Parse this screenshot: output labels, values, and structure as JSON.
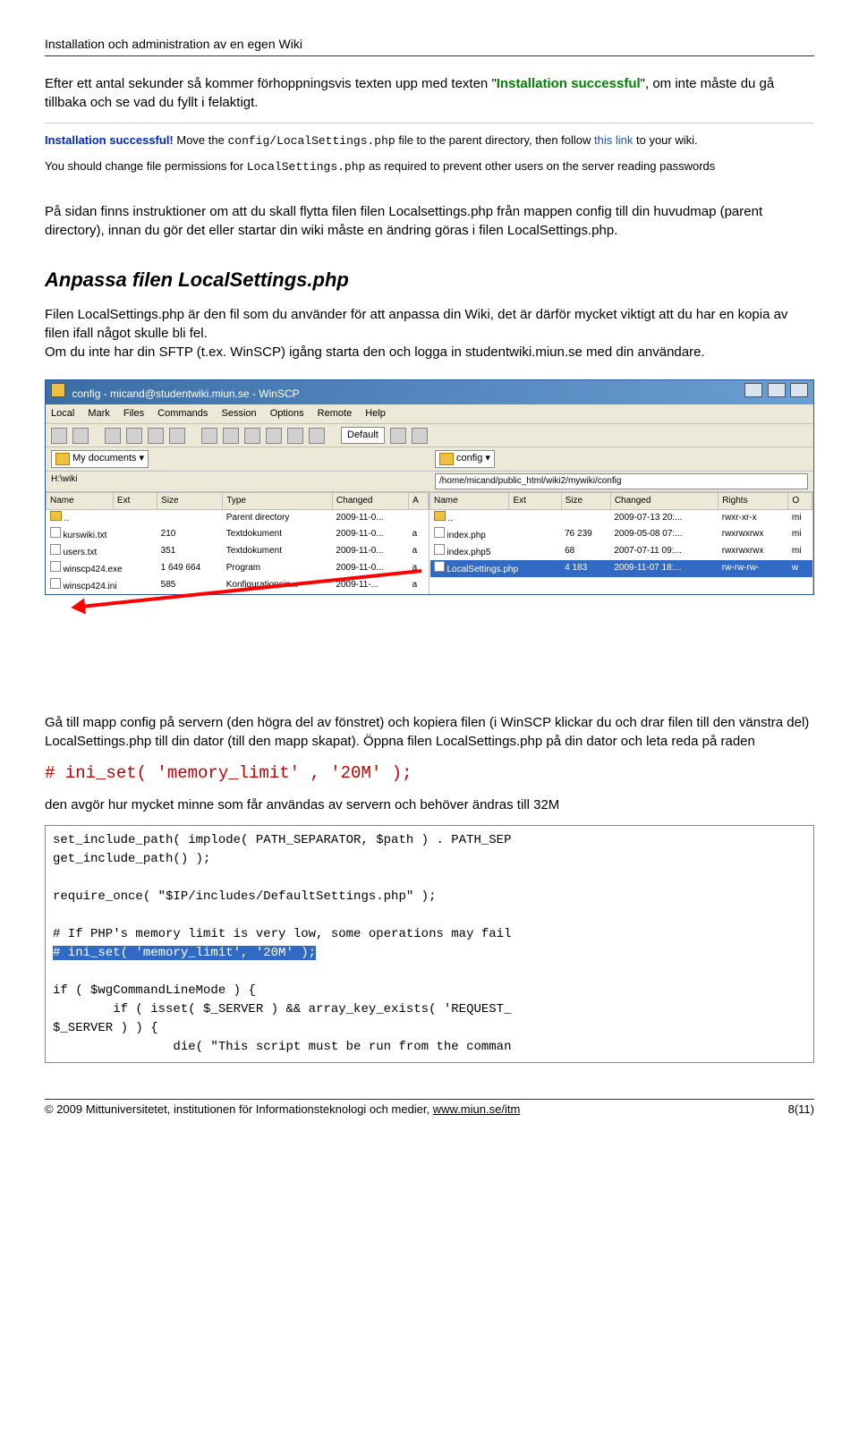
{
  "header": "Installation och administration av en egen Wiki",
  "p1a": "Efter ett antal sekunder så kommer förhoppningsvis texten upp med texten \"",
  "p1b": "Installation successful",
  "p1c": "\", om inte måste du gå tillbaka och se vad du fyllt i felaktigt.",
  "install_box": {
    "l1a": "Installation successful!",
    "l1b": " Move the ",
    "l1c": "config/LocalSettings.php",
    "l1d": " file to the parent directory, then follow ",
    "l1e": "this link",
    "l1f": " to your wiki.",
    "l2a": "You should change file permissions for ",
    "l2b": "LocalSettings.php",
    "l2c": " as required to prevent other users on the server reading passwords"
  },
  "p2": "På sidan finns instruktioner om att du skall flytta filen filen Localsettings.php från mappen config till  din huvudmap (parent directory), innan du  gör det eller startar din wiki måste en ändring göras i filen LocalSettings.php.",
  "h2": "Anpassa filen LocalSettings.php",
  "p3": "Filen LocalSettings.php är den fil som du använder för att anpassa din Wiki, det är därför mycket viktigt att du har en kopia av filen ifall något skulle bli fel.\nOm du inte har din SFTP (t.ex. WinSCP) igång starta den och logga in studentwiki.miun.se med din användare.",
  "winscp": {
    "title": "config - micand@studentwiki.miun.se - WinSCP",
    "menu": [
      "Local",
      "Mark",
      "Files",
      "Commands",
      "Session",
      "Options",
      "Remote",
      "Help"
    ],
    "combo": "Default",
    "left_dropdown": "My documents",
    "right_dropdown": "config",
    "left_loc": "H:\\wiki",
    "right_path": "/home/micand/public_html/wiki2/mywiki/config",
    "left_cols": [
      "Name",
      "Ext",
      "Size",
      "Type",
      "Changed",
      "A"
    ],
    "right_cols": [
      "Name",
      "Ext",
      "Size",
      "Changed",
      "Rights",
      "O"
    ],
    "left_rows": [
      {
        "name": "..",
        "size": "",
        "type": "Parent directory",
        "changed": "2009-11-0...",
        "a": ""
      },
      {
        "name": "kurswiki.txt",
        "size": "210",
        "type": "Textdokument",
        "changed": "2009-11-0...",
        "a": "a"
      },
      {
        "name": "users.txt",
        "size": "351",
        "type": "Textdokument",
        "changed": "2009-11-0...",
        "a": "a"
      },
      {
        "name": "winscp424.exe",
        "size": "1 649 664",
        "type": "Program",
        "changed": "2009-11-0...",
        "a": "a"
      },
      {
        "name": "winscp424.ini",
        "size": "585",
        "type": "Konfigurationsin...",
        "changed": "2009-11-...",
        "a": "a"
      }
    ],
    "right_rows": [
      {
        "name": "..",
        "size": "",
        "changed": "2009-07-13 20:...",
        "rights": "rwxr-xr-x",
        "o": "mi"
      },
      {
        "name": "index.php",
        "size": "76 239",
        "changed": "2009-05-08 07:...",
        "rights": "rwxrwxrwx",
        "o": "mi"
      },
      {
        "name": "index.php5",
        "size": "68",
        "changed": "2007-07-11 09:...",
        "rights": "rwxrwxrwx",
        "o": "mi"
      },
      {
        "name": "LocalSettings.php",
        "size": "4 183",
        "changed": "2009-11-07 18:...",
        "rights": "rw-rw-rw-",
        "o": "w"
      }
    ]
  },
  "p4": "Gå till mapp config på servern (den högra del av fönstret) och kopiera filen (i WinSCP klickar du och drar filen till den vänstra del) LocalSettings.php till din dator (till den mapp skapat). Öppna filen LocalSettings.php på din dator och leta reda på raden",
  "code_red": "# ini_set( 'memory_limit' , '20M' );",
  "p5": "den avgör hur mycket minne som får användas av servern och behöver ändras till 32M",
  "php": {
    "l1": "set_include_path( implode( PATH_SEPARATOR, $path ) . PATH_SEP",
    "l2": "get_include_path() );",
    "l3": "",
    "l4": "require_once( \"$IP/includes/DefaultSettings.php\" );",
    "l5": "",
    "l6": "# If PHP's memory limit is very low, some operations may fail",
    "l7": "# ini_set( 'memory_limit', '20M' );",
    "l8": "",
    "l9": "if ( $wgCommandLineMode ) {",
    "l10": "        if ( isset( $_SERVER ) && array_key_exists( 'REQUEST_",
    "l11": "$_SERVER ) ) {",
    "l12": "                die( \"This script must be run from the comman"
  },
  "footer": {
    "left": "© 2009 Mittuniversitetet, institutionen för Informationsteknologi och medier, ",
    "link": "www.miun.se/itm",
    "right": "8(11)"
  }
}
